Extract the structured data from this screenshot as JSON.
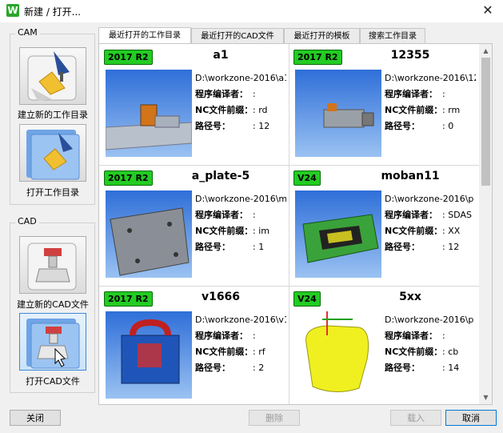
{
  "window": {
    "title": "新建 / 打开...",
    "app_icon": "W"
  },
  "cam": {
    "label": "CAM",
    "new_workdir": "建立新的工作目录",
    "open_workdir": "打开工作目录"
  },
  "cad": {
    "label": "CAD",
    "new_cad": "建立新的CAD文件",
    "open_cad": "打开CAD文件"
  },
  "tabs": [
    "最近打开的工作目录",
    "最近打开的CAD文件",
    "最近打开的模板",
    "搜索工作目录"
  ],
  "fields": {
    "programmer": "程序编译者：",
    "nc_prefix": "NC文件前缀：",
    "path_no": "路径号："
  },
  "cards": [
    {
      "badge": "2017 R2",
      "name": "a1",
      "path": "D:\\workzone-2016\\a1",
      "programmer": ":",
      "nc_prefix": ": rd",
      "path_no": ": 12"
    },
    {
      "badge": "2017 R2",
      "name": "12355",
      "path": "D:\\workzone-2016\\12",
      "programmer": ":",
      "nc_prefix": ": rm",
      "path_no": ": 0"
    },
    {
      "badge": "2017 R2",
      "name": "a_plate-5",
      "path": "D:\\workzone-2016\\m",
      "programmer": ":",
      "nc_prefix": ": im",
      "path_no": ": 1"
    },
    {
      "badge": "V24",
      "name": "moban11",
      "path": "D:\\workzone-2016\\p",
      "programmer": ": SDAS",
      "nc_prefix": ": XX",
      "path_no": ": 12"
    },
    {
      "badge": "2017 R2",
      "name": "v1666",
      "path": "D:\\workzone-2016\\v1",
      "programmer": ":",
      "nc_prefix": ": rf",
      "path_no": ": 2"
    },
    {
      "badge": "V24",
      "name": "5xx",
      "path": "D:\\workzone-2016\\p",
      "programmer": ":",
      "nc_prefix": ": cb",
      "path_no": ": 14"
    }
  ],
  "buttons": {
    "close": "关闭",
    "delete": "删除",
    "load": "载入",
    "cancel": "取消"
  },
  "colors": {
    "badge_green": "#22cc22",
    "model_blue": "#2a6fd0",
    "selected_blue": "#c9e3f8"
  }
}
